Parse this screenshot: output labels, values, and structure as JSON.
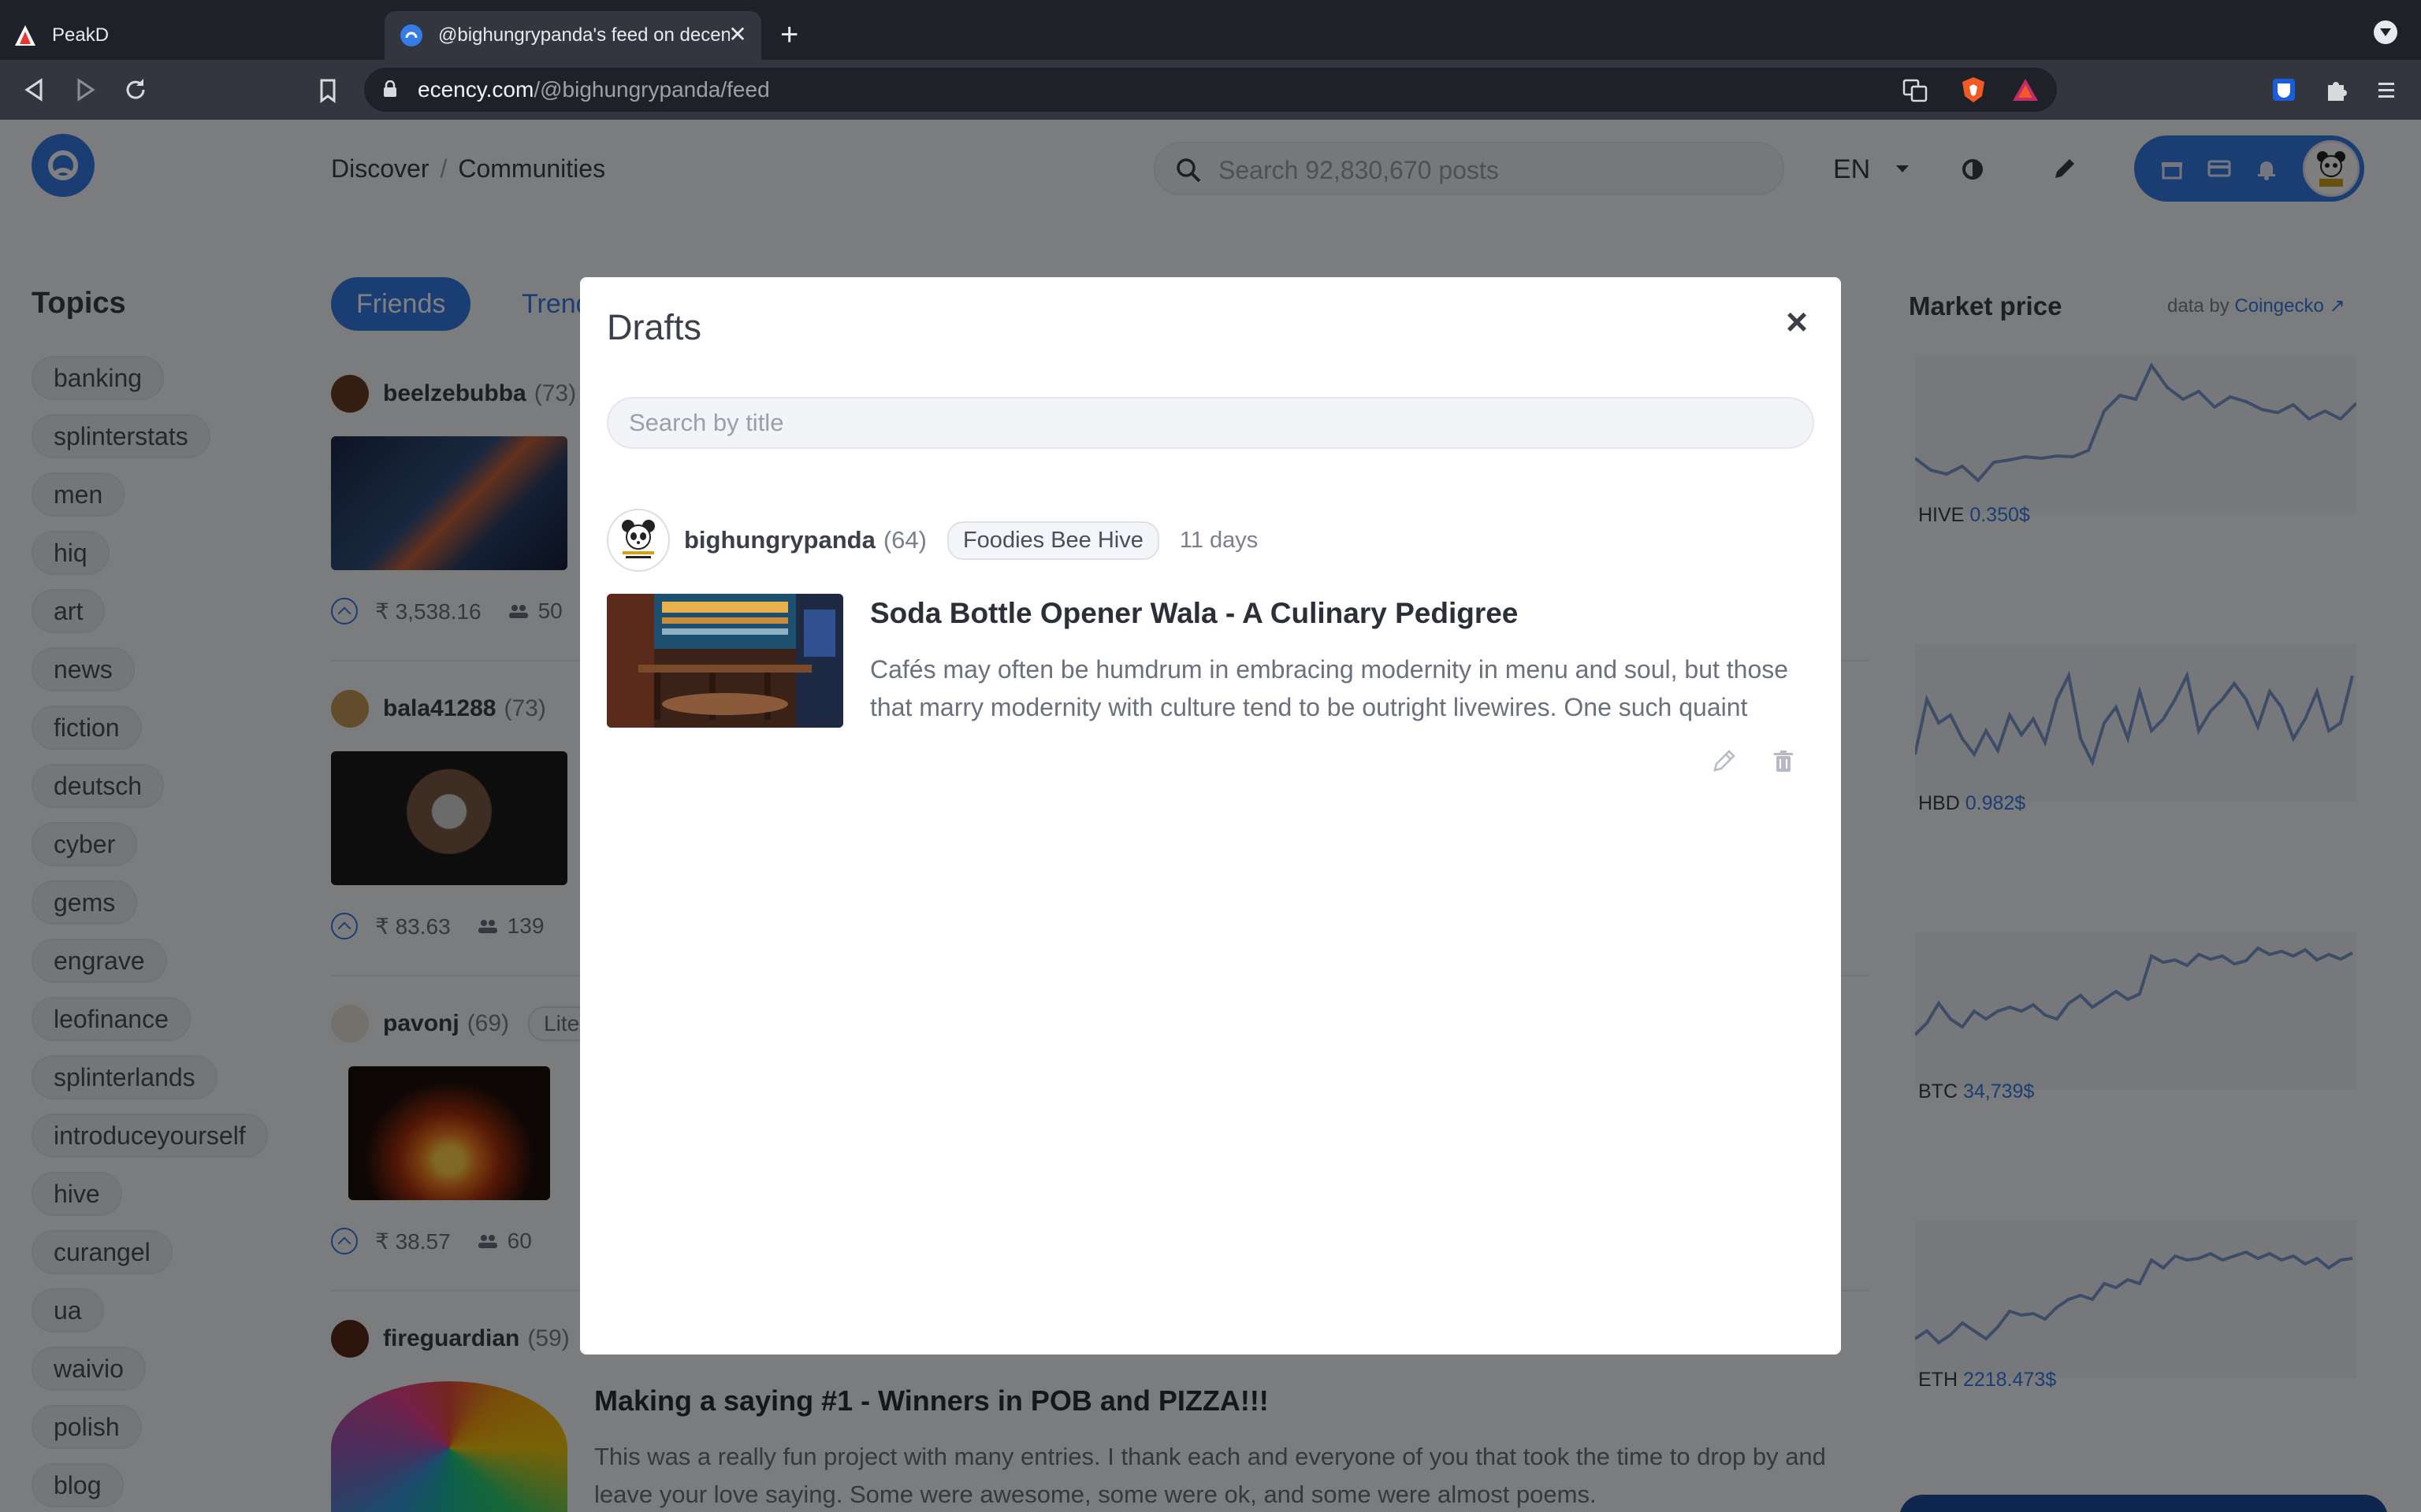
{
  "browser": {
    "tabs": [
      {
        "title": "PeakD"
      },
      {
        "title": "@bighungrypanda's feed on decentralized web"
      }
    ],
    "url_host": "ecency.com",
    "url_path": "/@bighungrypanda/feed",
    "new_tab": "+",
    "close_tab": "✕"
  },
  "header": {
    "breadcrumb": [
      "Discover",
      "Communities"
    ],
    "breadcrumb_sep": "/",
    "search_placeholder": "Search 92,830,670 posts",
    "language": "EN"
  },
  "sidebar": {
    "title": "Topics",
    "topics": [
      "banking",
      "splinterstats",
      "men",
      "hiq",
      "art",
      "news",
      "fiction",
      "deutsch",
      "cyber",
      "gems",
      "engrave",
      "leofinance",
      "splinterlands",
      "introduceyourself",
      "hive",
      "curangel",
      "ua",
      "waivio",
      "polish",
      "blog"
    ]
  },
  "feed": {
    "tabs": [
      "Friends",
      "Trending"
    ],
    "posts": [
      {
        "author": "beelzebubba",
        "rep": "(73)",
        "payout": "₹ 3,538.16",
        "votes": "50"
      },
      {
        "author": "bala41288",
        "rep": "(73)",
        "payout": "₹ 83.63",
        "votes": "139"
      },
      {
        "author": "pavonj",
        "rep": "(69)",
        "community": "Lite",
        "payout": "₹ 38.57",
        "votes": "60"
      },
      {
        "author": "fireguardian",
        "rep": "(59)",
        "title": "Making a saying #1 - Winners in POB and PIZZA!!!",
        "body": "This was a really fun project with many entries. I thank each and everyone of you that took the time to drop by and leave your love saying. Some were awesome, some were ok, and some were almost poems."
      }
    ]
  },
  "market": {
    "title": "Market price",
    "by_prefix": "data by",
    "by_source": "Coingecko",
    "coins": [
      {
        "symbol": "HIVE",
        "price": "0.350$"
      },
      {
        "symbol": "HBD",
        "price": "0.982$"
      },
      {
        "symbol": "BTC",
        "price": "34,739$"
      },
      {
        "symbol": "ETH",
        "price": "2218.473$"
      }
    ],
    "colors": {
      "line": "#7b9bd1",
      "fill": "#eef1f6"
    }
  },
  "modal": {
    "title": "Drafts",
    "close": "×",
    "search_placeholder": "Search by title",
    "draft": {
      "author": "bighungrypanda",
      "rep": "(64)",
      "community": "Foodies Bee Hive",
      "age": "11 days",
      "title": "Soda Bottle Opener Wala - A Culinary Pedigree",
      "body": "Cafés may often be humdrum in embracing modernity in menu and soul, but those that marry modernity with culture tend to be outright livewires. One such quaint"
    }
  },
  "colors": {
    "brand": "#357ce6",
    "overlay": "rgba(0,0,0,0.5)"
  }
}
